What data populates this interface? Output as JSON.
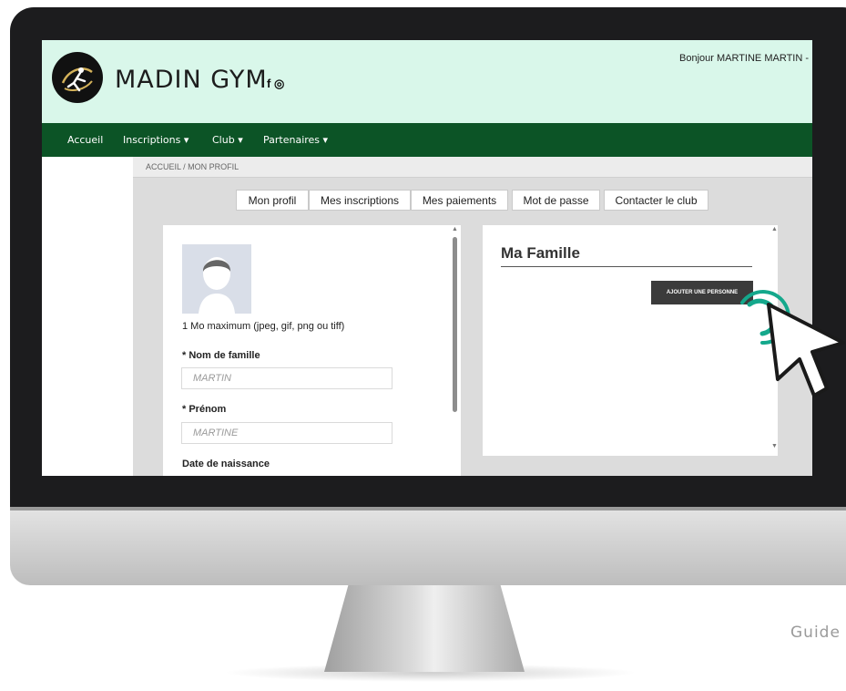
{
  "header": {
    "brand_name": "MADIN GYM",
    "social_icons": "f ◎",
    "greeting": "Bonjour MARTINE MARTIN -"
  },
  "nav": {
    "items": [
      "Accueil",
      "Inscriptions ▾",
      "Club ▾",
      "Partenaires ▾"
    ]
  },
  "breadcrumb": {
    "text": "ACCUEIL  /  MON PROFIL"
  },
  "tabs": [
    "Mon profil",
    "Mes inscriptions",
    "Mes paiements",
    "Mot de passe",
    "Contacter le club"
  ],
  "profile": {
    "photo_hint": "1 Mo maximum (jpeg, gif, png ou tiff)",
    "last_name_label": "* Nom de famille",
    "last_name_value": "MARTIN",
    "first_name_label": "* Prénom",
    "first_name_value": "MARTINE",
    "birthdate_label": "Date de naissance"
  },
  "family": {
    "title": "Ma Famille",
    "add_button": "AJOUTER UNE PERSONNE"
  },
  "footer": {
    "guide_text": "Guide"
  },
  "colors": {
    "header_bg": "#d9f7ea",
    "nav_bg": "#0c5426",
    "accent_teal": "#14a88c"
  },
  "icons": {
    "logo": "gymnast-logo",
    "avatar": "user-silhouette-icon",
    "cursor": "mouse-pointer-icon",
    "click": "click-ripple-icon"
  }
}
